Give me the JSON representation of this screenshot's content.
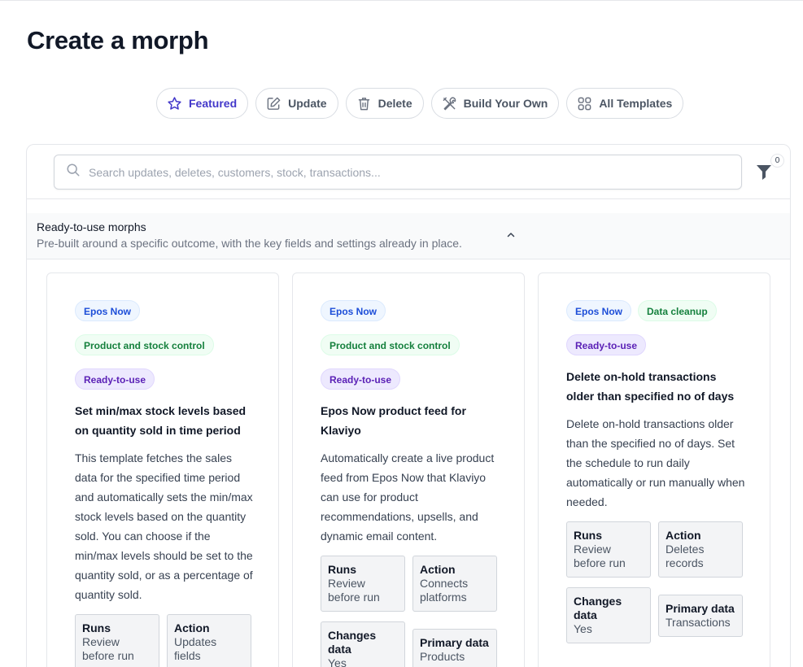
{
  "page": {
    "title": "Create a morph"
  },
  "tabs": [
    {
      "label": "Featured",
      "icon": "star-icon",
      "active": true
    },
    {
      "label": "Update",
      "icon": "pencil-icon",
      "active": false
    },
    {
      "label": "Delete",
      "icon": "trash-icon",
      "active": false
    },
    {
      "label": "Build Your Own",
      "icon": "tools-icon",
      "active": false
    },
    {
      "label": "All Templates",
      "icon": "grid-icon",
      "active": false
    }
  ],
  "search": {
    "placeholder": "Search updates, deletes, customers, stock, transactions...",
    "value": ""
  },
  "filter": {
    "count": "0"
  },
  "section": {
    "title": "Ready-to-use morphs",
    "subtitle": "Pre-built around a specific outcome, with the key fields and settings already in place."
  },
  "cards": [
    {
      "badges": [
        "Epos Now",
        "Product and stock control",
        "Ready-to-use"
      ],
      "title": "Set min/max stock levels based on quantity sold in time period",
      "description": "This template fetches the sales data for the specified time period and automatically sets the min/max stock levels based on the quantity sold. You can choose if the min/max levels should be set to the quantity sold, or as a percentage of quantity sold.",
      "meta": [
        {
          "key": "Runs",
          "value": "Review before run"
        },
        {
          "key": "Action",
          "value": "Updates fields"
        }
      ]
    },
    {
      "badges": [
        "Epos Now",
        "Product and stock control",
        "Ready-to-use"
      ],
      "title": "Epos Now product feed for Klaviyo",
      "description": "Automatically create a live product feed from Epos Now that Klaviyo can use for product recommendations, upsells, and dynamic email content.",
      "meta": [
        {
          "key": "Runs",
          "value": "Review before run"
        },
        {
          "key": "Action",
          "value": "Connects platforms"
        },
        {
          "key": "Changes data",
          "value": "Yes"
        },
        {
          "key": "Primary data",
          "value": "Products"
        }
      ]
    },
    {
      "badges": [
        "Epos Now",
        "Data cleanup",
        "Ready-to-use"
      ],
      "title": "Delete on-hold transactions older than specified no of days",
      "description": "Delete on-hold transactions older than the specified no of days. Set the schedule to run daily automatically or run manually when needed.",
      "meta": [
        {
          "key": "Runs",
          "value": "Review before run"
        },
        {
          "key": "Action",
          "value": "Deletes records"
        },
        {
          "key": "Changes data",
          "value": "Yes"
        },
        {
          "key": "Primary data",
          "value": "Transactions"
        }
      ]
    }
  ]
}
